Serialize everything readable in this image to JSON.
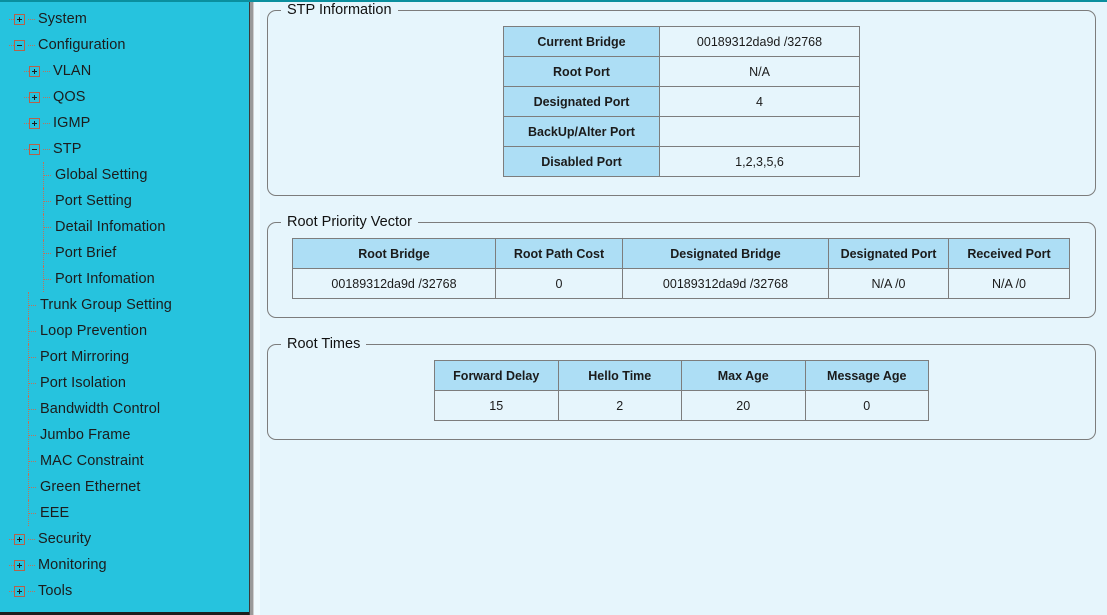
{
  "sidebar": {
    "items": [
      {
        "label": "System",
        "level": 0,
        "type": "branch",
        "state": "collapsed"
      },
      {
        "label": "Configuration",
        "level": 0,
        "type": "branch",
        "state": "expanded"
      },
      {
        "label": "VLAN",
        "level": 1,
        "type": "branch",
        "state": "collapsed"
      },
      {
        "label": "QOS",
        "level": 1,
        "type": "branch",
        "state": "collapsed"
      },
      {
        "label": "IGMP",
        "level": 1,
        "type": "branch",
        "state": "collapsed"
      },
      {
        "label": "STP",
        "level": 1,
        "type": "branch",
        "state": "expanded"
      },
      {
        "label": "Global Setting",
        "level": 2,
        "type": "leaf"
      },
      {
        "label": "Port Setting",
        "level": 2,
        "type": "leaf"
      },
      {
        "label": "Detail Infomation",
        "level": 2,
        "type": "leaf"
      },
      {
        "label": "Port Brief",
        "level": 2,
        "type": "leaf"
      },
      {
        "label": "Port Infomation",
        "level": 2,
        "type": "leaf"
      },
      {
        "label": "Trunk Group Setting",
        "level": 1,
        "type": "leaf"
      },
      {
        "label": "Loop Prevention",
        "level": 1,
        "type": "leaf"
      },
      {
        "label": "Port Mirroring",
        "level": 1,
        "type": "leaf"
      },
      {
        "label": "Port Isolation",
        "level": 1,
        "type": "leaf"
      },
      {
        "label": "Bandwidth Control",
        "level": 1,
        "type": "leaf"
      },
      {
        "label": "Jumbo Frame",
        "level": 1,
        "type": "leaf"
      },
      {
        "label": "MAC Constraint",
        "level": 1,
        "type": "leaf"
      },
      {
        "label": "Green Ethernet",
        "level": 1,
        "type": "leaf"
      },
      {
        "label": "EEE",
        "level": 1,
        "type": "leaf"
      },
      {
        "label": "Security",
        "level": 0,
        "type": "branch",
        "state": "collapsed"
      },
      {
        "label": "Monitoring",
        "level": 0,
        "type": "branch",
        "state": "collapsed"
      },
      {
        "label": "Tools",
        "level": 0,
        "type": "branch",
        "state": "collapsed"
      }
    ]
  },
  "panels": {
    "stp_information": {
      "legend": "STP Information",
      "rows": [
        {
          "label": "Current Bridge",
          "value": "00189312da9d /32768"
        },
        {
          "label": "Root Port",
          "value": "N/A"
        },
        {
          "label": "Designated Port",
          "value": "4"
        },
        {
          "label": "BackUp/Alter Port",
          "value": ""
        },
        {
          "label": "Disabled Port",
          "value": "1,2,3,5,6"
        }
      ]
    },
    "root_priority_vector": {
      "legend": "Root Priority Vector",
      "headers": [
        "Root Bridge",
        "Root Path Cost",
        "Designated Bridge",
        "Designated Port",
        "Received Port"
      ],
      "rows": [
        [
          "00189312da9d /32768",
          "0",
          "00189312da9d /32768",
          "N/A /0",
          "N/A /0"
        ]
      ]
    },
    "root_times": {
      "legend": "Root Times",
      "headers": [
        "Forward Delay",
        "Hello Time",
        "Max Age",
        "Message Age"
      ],
      "rows": [
        [
          "15",
          "2",
          "20",
          "0"
        ]
      ]
    }
  },
  "colors": {
    "sidebar_bg": "#26c3de",
    "content_bg": "#e6f5fc",
    "table_header_bg": "#addef5",
    "table_border": "#7d7d7d",
    "expander_border": "#b4624a",
    "top_rule": "#0a8f9e"
  }
}
